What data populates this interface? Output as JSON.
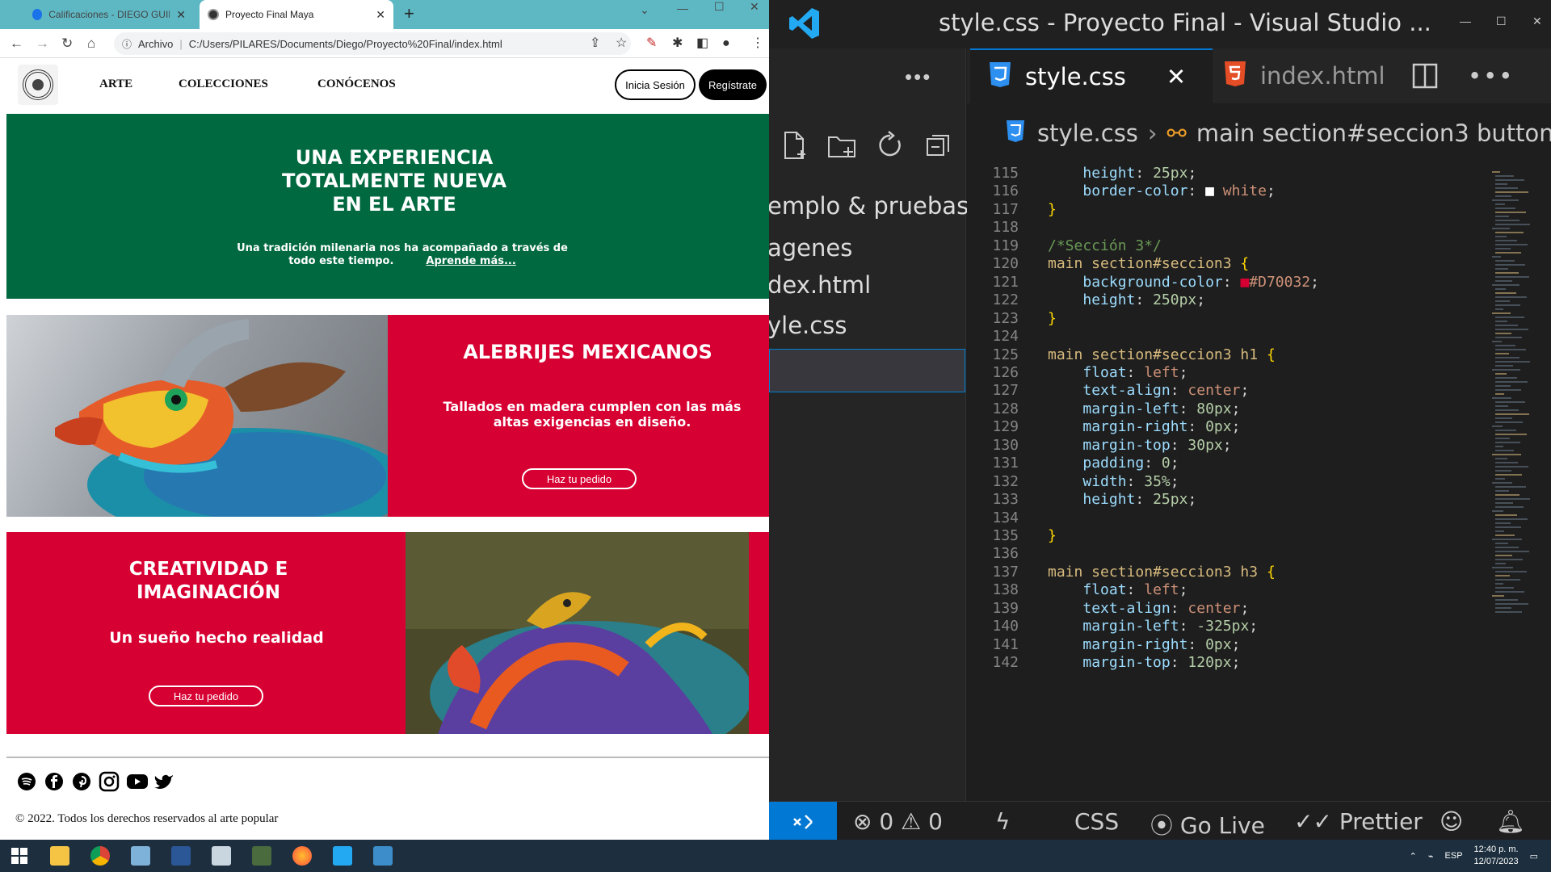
{
  "browser": {
    "tabs": [
      {
        "title": "Calificaciones - DIEGO GUILLERM"
      },
      {
        "title": "Proyecto Final Maya"
      }
    ],
    "address": {
      "scheme_label": "Archivo",
      "url": "C:/Users/PILARES/Documents/Diego/Proyecto%20Final/index.html"
    }
  },
  "site": {
    "nav": [
      "ARTE",
      "COLECCIONES",
      "CONÓCENOS"
    ],
    "login_label": "Inicia Sesión",
    "register_label": "Regístrate",
    "hero": {
      "title": "UNA EXPERIENCIA\nTOTALMENTE NUEVA\nEN EL ARTE",
      "text": "Una tradición milenaria nos ha acompañado a través de todo este tiempo.",
      "link": "Aprende más..."
    },
    "section2": {
      "title": "ALEBRIJES MEXICANOS",
      "text": "Tallados en madera cumplen con las más altas exigencias en diseño.",
      "button": "Haz tu pedido"
    },
    "section3": {
      "title": "CREATIVIDAD E\nIMAGINACIÓN",
      "subtitle": "Un sueño hecho realidad",
      "button": "Haz tu pedido"
    },
    "social_icons": [
      "spotify-icon",
      "facebook-icon",
      "pinterest-icon",
      "instagram-icon",
      "youtube-icon",
      "twitter-icon"
    ],
    "copyright": "© 2022. Todos los derechos reservados al arte popular"
  },
  "vscode": {
    "title": "style.css - Proyecto Final - Visual Studio ...",
    "explorer_items": [
      "emplo & pruebas",
      "agenes",
      "dex.html",
      "yle.css"
    ],
    "tabs": [
      "style.css",
      "index.html"
    ],
    "breadcrumb": [
      "style.css",
      "main section#seccion3 button"
    ],
    "lines": [
      {
        "n": "115",
        "parts": [
          [
            "    ",
            "pun"
          ],
          [
            "height",
            "prop"
          ],
          [
            ": ",
            "pun"
          ],
          [
            "25px",
            "num"
          ],
          [
            ";",
            "pun"
          ]
        ]
      },
      {
        "n": "116",
        "parts": [
          [
            "    ",
            "pun"
          ],
          [
            "border-color",
            "prop"
          ],
          [
            ": ",
            "pun"
          ],
          [
            "■",
            "swatch-white"
          ],
          [
            "white",
            "val"
          ],
          [
            ";",
            "pun"
          ]
        ]
      },
      {
        "n": "117",
        "parts": [
          [
            "}",
            "brace"
          ]
        ]
      },
      {
        "n": "118",
        "parts": []
      },
      {
        "n": "119",
        "parts": [
          [
            "/*Sección 3*/",
            "com"
          ]
        ]
      },
      {
        "n": "120",
        "parts": [
          [
            "main section#seccion3 ",
            "sel"
          ],
          [
            "{",
            "brace"
          ]
        ]
      },
      {
        "n": "121",
        "parts": [
          [
            "    ",
            "pun"
          ],
          [
            "background-color",
            "prop"
          ],
          [
            ": ",
            "pun"
          ],
          [
            "■",
            "swatch-red"
          ],
          [
            "#D70032",
            "val"
          ],
          [
            ";",
            "pun"
          ]
        ]
      },
      {
        "n": "122",
        "parts": [
          [
            "    ",
            "pun"
          ],
          [
            "height",
            "prop"
          ],
          [
            ": ",
            "pun"
          ],
          [
            "250px",
            "num"
          ],
          [
            ";",
            "pun"
          ]
        ]
      },
      {
        "n": "123",
        "parts": [
          [
            "}",
            "brace"
          ]
        ]
      },
      {
        "n": "124",
        "parts": []
      },
      {
        "n": "125",
        "parts": [
          [
            "main section#seccion3 h1 ",
            "sel"
          ],
          [
            "{",
            "brace"
          ]
        ]
      },
      {
        "n": "126",
        "parts": [
          [
            "    ",
            "pun"
          ],
          [
            "float",
            "prop"
          ],
          [
            ": ",
            "pun"
          ],
          [
            "left",
            "val"
          ],
          [
            ";",
            "pun"
          ]
        ]
      },
      {
        "n": "127",
        "parts": [
          [
            "    ",
            "pun"
          ],
          [
            "text-align",
            "prop"
          ],
          [
            ": ",
            "pun"
          ],
          [
            "center",
            "val"
          ],
          [
            ";",
            "pun"
          ]
        ]
      },
      {
        "n": "128",
        "parts": [
          [
            "    ",
            "pun"
          ],
          [
            "margin-left",
            "prop"
          ],
          [
            ": ",
            "pun"
          ],
          [
            "80px",
            "num"
          ],
          [
            ";",
            "pun"
          ]
        ]
      },
      {
        "n": "129",
        "parts": [
          [
            "    ",
            "pun"
          ],
          [
            "margin-right",
            "prop"
          ],
          [
            ": ",
            "pun"
          ],
          [
            "0px",
            "num"
          ],
          [
            ";",
            "pun"
          ]
        ]
      },
      {
        "n": "130",
        "parts": [
          [
            "    ",
            "pun"
          ],
          [
            "margin-top",
            "prop"
          ],
          [
            ": ",
            "pun"
          ],
          [
            "30px",
            "num"
          ],
          [
            ";",
            "pun"
          ]
        ]
      },
      {
        "n": "131",
        "parts": [
          [
            "    ",
            "pun"
          ],
          [
            "padding",
            "prop"
          ],
          [
            ": ",
            "pun"
          ],
          [
            "0",
            "num"
          ],
          [
            ";",
            "pun"
          ]
        ]
      },
      {
        "n": "132",
        "parts": [
          [
            "    ",
            "pun"
          ],
          [
            "width",
            "prop"
          ],
          [
            ": ",
            "pun"
          ],
          [
            "35%",
            "num"
          ],
          [
            ";",
            "pun"
          ]
        ]
      },
      {
        "n": "133",
        "parts": [
          [
            "    ",
            "pun"
          ],
          [
            "height",
            "prop"
          ],
          [
            ": ",
            "pun"
          ],
          [
            "25px",
            "num"
          ],
          [
            ";",
            "pun"
          ]
        ]
      },
      {
        "n": "134",
        "parts": []
      },
      {
        "n": "135",
        "parts": [
          [
            "}",
            "brace"
          ]
        ]
      },
      {
        "n": "136",
        "parts": []
      },
      {
        "n": "137",
        "parts": [
          [
            "main section#seccion3 h3 ",
            "sel"
          ],
          [
            "{",
            "brace"
          ]
        ]
      },
      {
        "n": "138",
        "parts": [
          [
            "    ",
            "pun"
          ],
          [
            "float",
            "prop"
          ],
          [
            ": ",
            "pun"
          ],
          [
            "left",
            "val"
          ],
          [
            ";",
            "pun"
          ]
        ]
      },
      {
        "n": "139",
        "parts": [
          [
            "    ",
            "pun"
          ],
          [
            "text-align",
            "prop"
          ],
          [
            ": ",
            "pun"
          ],
          [
            "center",
            "val"
          ],
          [
            ";",
            "pun"
          ]
        ]
      },
      {
        "n": "140",
        "parts": [
          [
            "    ",
            "pun"
          ],
          [
            "margin-left",
            "prop"
          ],
          [
            ": ",
            "pun"
          ],
          [
            "-325px",
            "num"
          ],
          [
            ";",
            "pun"
          ]
        ]
      },
      {
        "n": "141",
        "parts": [
          [
            "    ",
            "pun"
          ],
          [
            "margin-right",
            "prop"
          ],
          [
            ": ",
            "pun"
          ],
          [
            "0px",
            "num"
          ],
          [
            ";",
            "pun"
          ]
        ]
      },
      {
        "n": "142",
        "parts": [
          [
            "    ",
            "pun"
          ],
          [
            "margin-top",
            "prop"
          ],
          [
            ": ",
            "pun"
          ],
          [
            "120px",
            "num"
          ],
          [
            ";",
            "pun"
          ]
        ]
      }
    ],
    "status": {
      "errors": "0",
      "warnings": "0",
      "language": "CSS",
      "golive": "Go Live",
      "prettier": "Prettier"
    }
  },
  "taskbar": {
    "lang": "ESP",
    "time": "12:40 p. m.",
    "date": "12/07/2023"
  },
  "colors": {
    "hero_green": "#006940",
    "section_red": "#D70032",
    "vscode_blue": "#0078d4",
    "tab_teal": "#5eb8c4"
  }
}
